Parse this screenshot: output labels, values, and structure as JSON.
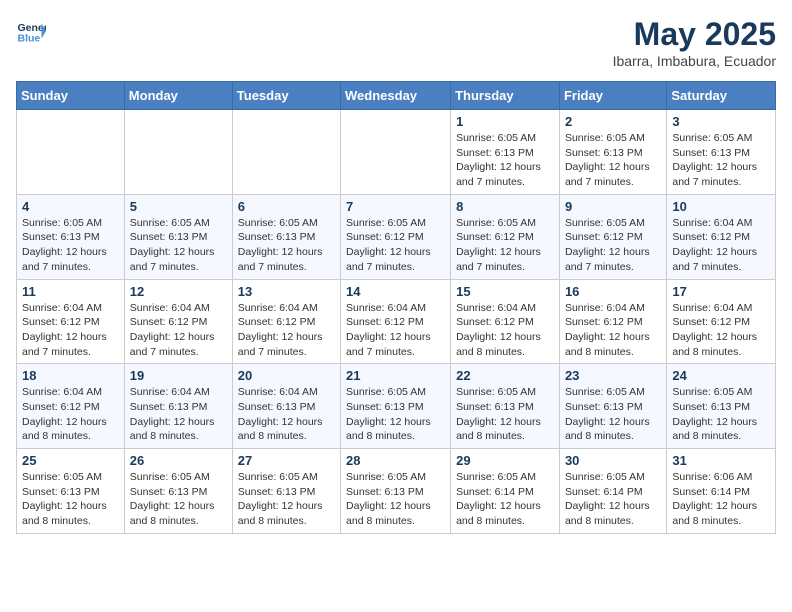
{
  "header": {
    "logo_line1": "General",
    "logo_line2": "Blue",
    "month": "May 2025",
    "location": "Ibarra, Imbabura, Ecuador"
  },
  "weekdays": [
    "Sunday",
    "Monday",
    "Tuesday",
    "Wednesday",
    "Thursday",
    "Friday",
    "Saturday"
  ],
  "weeks": [
    [
      {
        "day": "",
        "info": ""
      },
      {
        "day": "",
        "info": ""
      },
      {
        "day": "",
        "info": ""
      },
      {
        "day": "",
        "info": ""
      },
      {
        "day": "1",
        "info": "Sunrise: 6:05 AM\nSunset: 6:13 PM\nDaylight: 12 hours and 7 minutes."
      },
      {
        "day": "2",
        "info": "Sunrise: 6:05 AM\nSunset: 6:13 PM\nDaylight: 12 hours and 7 minutes."
      },
      {
        "day": "3",
        "info": "Sunrise: 6:05 AM\nSunset: 6:13 PM\nDaylight: 12 hours and 7 minutes."
      }
    ],
    [
      {
        "day": "4",
        "info": "Sunrise: 6:05 AM\nSunset: 6:13 PM\nDaylight: 12 hours and 7 minutes."
      },
      {
        "day": "5",
        "info": "Sunrise: 6:05 AM\nSunset: 6:13 PM\nDaylight: 12 hours and 7 minutes."
      },
      {
        "day": "6",
        "info": "Sunrise: 6:05 AM\nSunset: 6:13 PM\nDaylight: 12 hours and 7 minutes."
      },
      {
        "day": "7",
        "info": "Sunrise: 6:05 AM\nSunset: 6:12 PM\nDaylight: 12 hours and 7 minutes."
      },
      {
        "day": "8",
        "info": "Sunrise: 6:05 AM\nSunset: 6:12 PM\nDaylight: 12 hours and 7 minutes."
      },
      {
        "day": "9",
        "info": "Sunrise: 6:05 AM\nSunset: 6:12 PM\nDaylight: 12 hours and 7 minutes."
      },
      {
        "day": "10",
        "info": "Sunrise: 6:04 AM\nSunset: 6:12 PM\nDaylight: 12 hours and 7 minutes."
      }
    ],
    [
      {
        "day": "11",
        "info": "Sunrise: 6:04 AM\nSunset: 6:12 PM\nDaylight: 12 hours and 7 minutes."
      },
      {
        "day": "12",
        "info": "Sunrise: 6:04 AM\nSunset: 6:12 PM\nDaylight: 12 hours and 7 minutes."
      },
      {
        "day": "13",
        "info": "Sunrise: 6:04 AM\nSunset: 6:12 PM\nDaylight: 12 hours and 7 minutes."
      },
      {
        "day": "14",
        "info": "Sunrise: 6:04 AM\nSunset: 6:12 PM\nDaylight: 12 hours and 7 minutes."
      },
      {
        "day": "15",
        "info": "Sunrise: 6:04 AM\nSunset: 6:12 PM\nDaylight: 12 hours and 8 minutes."
      },
      {
        "day": "16",
        "info": "Sunrise: 6:04 AM\nSunset: 6:12 PM\nDaylight: 12 hours and 8 minutes."
      },
      {
        "day": "17",
        "info": "Sunrise: 6:04 AM\nSunset: 6:12 PM\nDaylight: 12 hours and 8 minutes."
      }
    ],
    [
      {
        "day": "18",
        "info": "Sunrise: 6:04 AM\nSunset: 6:12 PM\nDaylight: 12 hours and 8 minutes."
      },
      {
        "day": "19",
        "info": "Sunrise: 6:04 AM\nSunset: 6:13 PM\nDaylight: 12 hours and 8 minutes."
      },
      {
        "day": "20",
        "info": "Sunrise: 6:04 AM\nSunset: 6:13 PM\nDaylight: 12 hours and 8 minutes."
      },
      {
        "day": "21",
        "info": "Sunrise: 6:05 AM\nSunset: 6:13 PM\nDaylight: 12 hours and 8 minutes."
      },
      {
        "day": "22",
        "info": "Sunrise: 6:05 AM\nSunset: 6:13 PM\nDaylight: 12 hours and 8 minutes."
      },
      {
        "day": "23",
        "info": "Sunrise: 6:05 AM\nSunset: 6:13 PM\nDaylight: 12 hours and 8 minutes."
      },
      {
        "day": "24",
        "info": "Sunrise: 6:05 AM\nSunset: 6:13 PM\nDaylight: 12 hours and 8 minutes."
      }
    ],
    [
      {
        "day": "25",
        "info": "Sunrise: 6:05 AM\nSunset: 6:13 PM\nDaylight: 12 hours and 8 minutes."
      },
      {
        "day": "26",
        "info": "Sunrise: 6:05 AM\nSunset: 6:13 PM\nDaylight: 12 hours and 8 minutes."
      },
      {
        "day": "27",
        "info": "Sunrise: 6:05 AM\nSunset: 6:13 PM\nDaylight: 12 hours and 8 minutes."
      },
      {
        "day": "28",
        "info": "Sunrise: 6:05 AM\nSunset: 6:13 PM\nDaylight: 12 hours and 8 minutes."
      },
      {
        "day": "29",
        "info": "Sunrise: 6:05 AM\nSunset: 6:14 PM\nDaylight: 12 hours and 8 minutes."
      },
      {
        "day": "30",
        "info": "Sunrise: 6:05 AM\nSunset: 6:14 PM\nDaylight: 12 hours and 8 minutes."
      },
      {
        "day": "31",
        "info": "Sunrise: 6:06 AM\nSunset: 6:14 PM\nDaylight: 12 hours and 8 minutes."
      }
    ]
  ]
}
